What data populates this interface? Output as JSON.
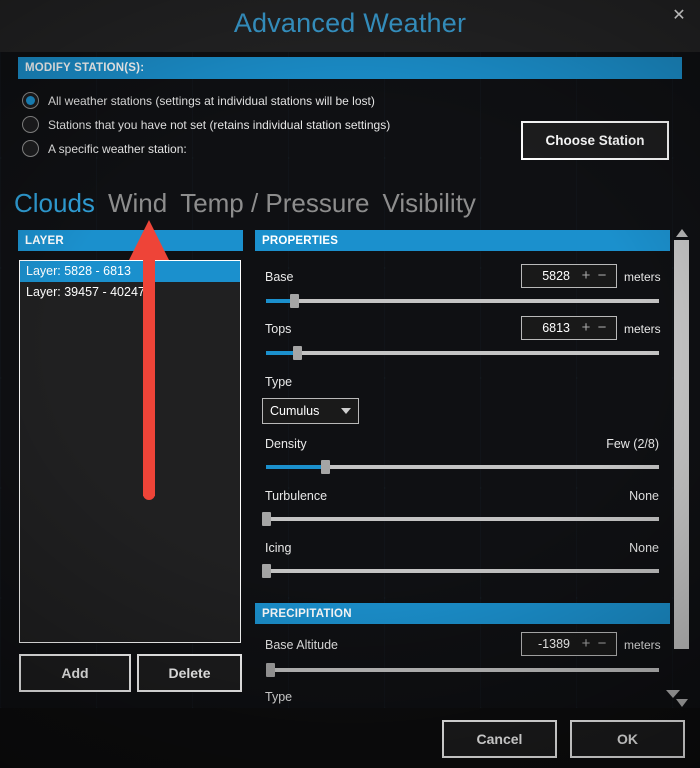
{
  "window": {
    "title": "Advanced Weather",
    "close_icon": "close-icon"
  },
  "modify_section": {
    "header": "MODIFY STATION(S):",
    "options": [
      {
        "label": "All weather stations (settings at individual stations will be lost)",
        "checked": true
      },
      {
        "label": "Stations that you have not set (retains individual station settings)",
        "checked": false
      },
      {
        "label": "A specific weather station:",
        "checked": false
      }
    ],
    "choose_station_button": "Choose Station"
  },
  "tabs": [
    {
      "label": "Clouds",
      "active": true
    },
    {
      "label": "Wind",
      "active": false
    },
    {
      "label": "Temp / Pressure",
      "active": false
    },
    {
      "label": "Visibility",
      "active": false
    }
  ],
  "layer_panel": {
    "header": "LAYER",
    "items": [
      {
        "label": "Layer: 5828 - 6813",
        "selected": true
      },
      {
        "label": "Layer: 39457 - 40247",
        "selected": false
      }
    ],
    "add_button": "Add",
    "delete_button": "Delete"
  },
  "properties_panel": {
    "header": "PROPERTIES",
    "base": {
      "label": "Base",
      "value": "5828",
      "unit": "meters",
      "plus": "+",
      "minus": "−",
      "slider_percent": 7
    },
    "tops": {
      "label": "Tops",
      "value": "6813",
      "unit": "meters",
      "plus": "+",
      "minus": "−",
      "slider_percent": 8
    },
    "type": {
      "label": "Type",
      "selected": "Cumulus"
    },
    "density": {
      "label": "Density",
      "value": "Few (2/8)",
      "slider_percent": 15
    },
    "turbulence": {
      "label": "Turbulence",
      "value": "None",
      "slider_percent": 0
    },
    "icing": {
      "label": "Icing",
      "value": "None",
      "slider_percent": 0
    }
  },
  "precipitation_panel": {
    "header": "PRECIPITATION",
    "base_altitude": {
      "label": "Base Altitude",
      "value": "-1389",
      "unit": "meters",
      "plus": "+",
      "minus": "−",
      "slider_percent": 1
    },
    "type": {
      "label": "Type"
    }
  },
  "footer": {
    "cancel_button": "Cancel",
    "ok_button": "OK"
  },
  "annotation": {
    "arrow_color": "#ee4438",
    "points_to": "Wind tab"
  },
  "colors": {
    "accent_blue": "#1b90cd",
    "title_blue": "#3a9fd4",
    "panel_dark": "#101114",
    "titlebar": "#232324"
  }
}
